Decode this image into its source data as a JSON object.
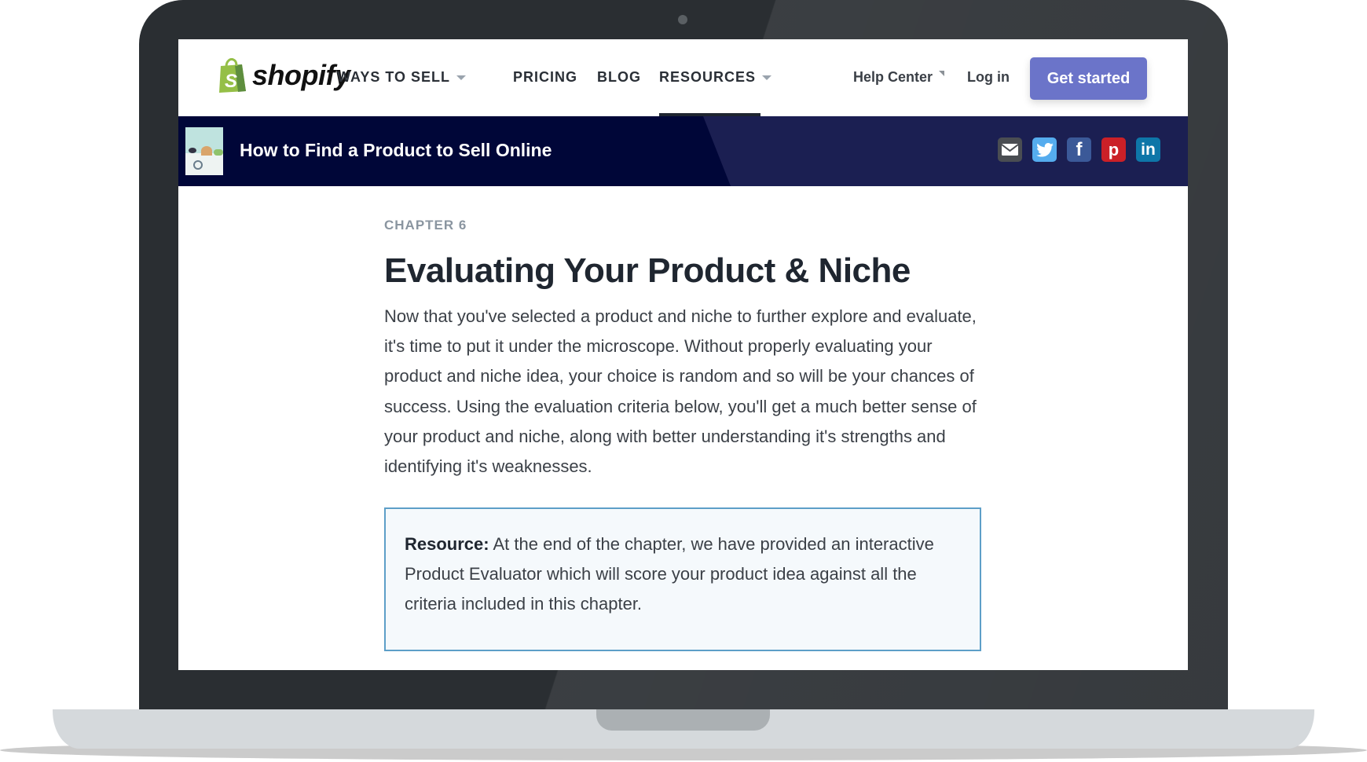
{
  "nav": {
    "logo_text": "shopify",
    "items": [
      {
        "label": "WAYS TO SELL",
        "has_dropdown": true
      },
      {
        "label": "PRICING",
        "has_dropdown": false
      },
      {
        "label": "BLOG",
        "has_dropdown": false
      },
      {
        "label": "RESOURCES",
        "has_dropdown": true,
        "active": true
      }
    ],
    "help_center": "Help Center",
    "login": "Log in",
    "cta": "Get started"
  },
  "banner": {
    "title": "How to Find a Product to Sell Online",
    "share_icons": [
      "email-icon",
      "twitter-icon",
      "facebook-icon",
      "pinterest-icon",
      "linkedin-icon"
    ],
    "facebook_glyph": "f",
    "pinterest_glyph": "p",
    "linkedin_glyph": "in"
  },
  "article": {
    "chapter": "CHAPTER 6",
    "title": "Evaluating Your Product & Niche",
    "intro": "Now that you've selected a product and niche to further explore and evaluate, it's time to put it under the microscope. Without properly evaluating your product and niche idea, your choice is random and so will be your chances of success. Using the evaluation criteria below, you'll get a much better sense of your product and niche, along with better understanding it's strengths and identifying it's weaknesses.",
    "resource_label": "Resource:",
    "resource_text": " At the end of the chapter, we have provided an interactive Product Evaluator which will score your product idea against all the criteria included in this chapter."
  },
  "colors": {
    "brand_green": "#95bf47",
    "cta": "#6b74c9",
    "banner": "#000638",
    "resource_border": "#5d9fc8"
  }
}
